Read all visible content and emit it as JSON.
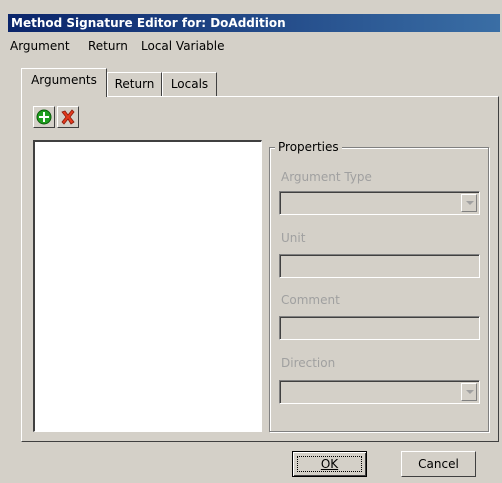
{
  "window": {
    "title": "Method Signature Editor for: DoAddition"
  },
  "menubar": {
    "items": [
      "Argument",
      "Return",
      "Local Variable"
    ]
  },
  "tabs": [
    {
      "label": "Arguments",
      "active": true
    },
    {
      "label": "Return",
      "active": false
    },
    {
      "label": "Locals",
      "active": false
    }
  ],
  "toolbar": {
    "add_icon": "green-plus-icon",
    "delete_icon": "red-x-icon"
  },
  "properties": {
    "legend": "Properties",
    "argument_type_label": "Argument Type",
    "unit_label": "Unit",
    "comment_label": "Comment",
    "direction_label": "Direction"
  },
  "buttons": {
    "ok": "OK",
    "cancel": "Cancel"
  }
}
